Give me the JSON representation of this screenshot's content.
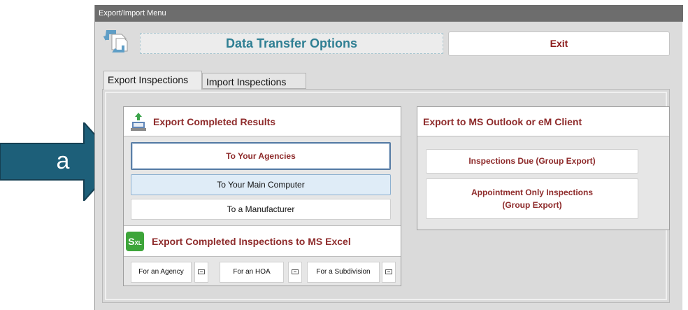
{
  "callout": {
    "label": "a",
    "color": "#1d5f79"
  },
  "window": {
    "title": "Export/Import Menu",
    "header_title": "Data Transfer Options",
    "exit_label": "Exit"
  },
  "tabs": [
    {
      "label": "Export Inspections",
      "active": true
    },
    {
      "label": "Import Inspections",
      "active": false
    }
  ],
  "export_results": {
    "title": "Export Completed Results",
    "icon": "export-computer-icon",
    "buttons": [
      "To Your Agencies",
      "To Your Main Computer",
      "To a Manufacturer"
    ]
  },
  "excel": {
    "icon_text": "S",
    "icon_sub": "XL",
    "title": "Export Completed Inspections to MS Excel",
    "buttons": [
      "For an Agency",
      "For an HOA",
      "For a Subdivision"
    ]
  },
  "outlook": {
    "title": "Export to MS Outlook or eM Client",
    "due_label": "Inspections Due (Group Export)",
    "appt_line1": "Appointment Only Inspections",
    "appt_line2": "(Group Export)"
  },
  "colors": {
    "accent_red": "#8e2b2b",
    "title_teal": "#2f7f93",
    "titlebar": "#6d6d6d"
  }
}
